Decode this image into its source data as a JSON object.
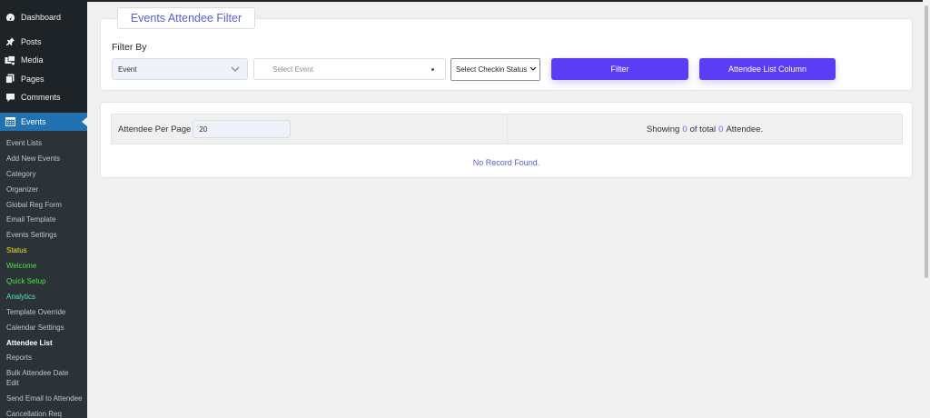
{
  "sidebar": {
    "menu": [
      {
        "label": "Dashboard",
        "icon": "dashboard-icon"
      },
      {
        "label": "Posts",
        "icon": "pin-icon"
      },
      {
        "label": "Media",
        "icon": "media-icon"
      },
      {
        "label": "Pages",
        "icon": "pages-icon"
      },
      {
        "label": "Comments",
        "icon": "comment-icon"
      },
      {
        "label": "Events",
        "icon": "calendar-icon"
      }
    ],
    "submenu": [
      "Event Lists",
      "Add New Events",
      "Category",
      "Organizer",
      "Global Reg Form",
      "Email Template",
      "Events Settings",
      "Status",
      "Welcome",
      "Quick Setup",
      "Analytics",
      "Template Override",
      "Calendar Settings",
      "Attendee List",
      "Reports",
      "Bulk Attendee Date Edit",
      "Send Email to Attendee",
      "Cancellation Req"
    ]
  },
  "filter": {
    "title": "Events Attendee Filter",
    "filter_by_label": "Filter By",
    "event_type_value": "Event",
    "select_event_placeholder": "Select Event",
    "checkin_status_value": "Select Checkin Status",
    "filter_button": "Filter",
    "column_button": "Attendee List Column"
  },
  "list": {
    "per_page_label": "Attendee Per Page",
    "per_page_value": "20",
    "showing_prefix": "Showing",
    "showing_count": "0",
    "showing_mid": "of total",
    "total_count": "0",
    "showing_suffix": "Attendee.",
    "no_record": "No Record Found."
  },
  "colors": {
    "accent": "#5b3df5",
    "sidebar_bg": "#1d2327",
    "active_menu": "#2271b1"
  }
}
